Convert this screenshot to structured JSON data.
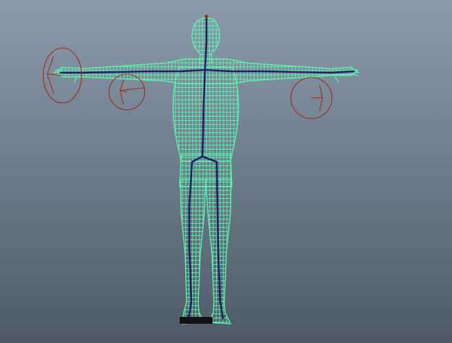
{
  "viewport": {
    "view": "3d-perspective",
    "shading": "wireframe",
    "background_gradient": [
      "#8b9bab",
      "#4f5a66"
    ]
  },
  "scene": {
    "mesh": {
      "pose": "t-pose",
      "wire_color": "#5cf5ac"
    },
    "skeleton": {
      "bone_color": "#1d1f66"
    },
    "ik_controls": {
      "count": 4,
      "color": "#a5260f"
    }
  }
}
